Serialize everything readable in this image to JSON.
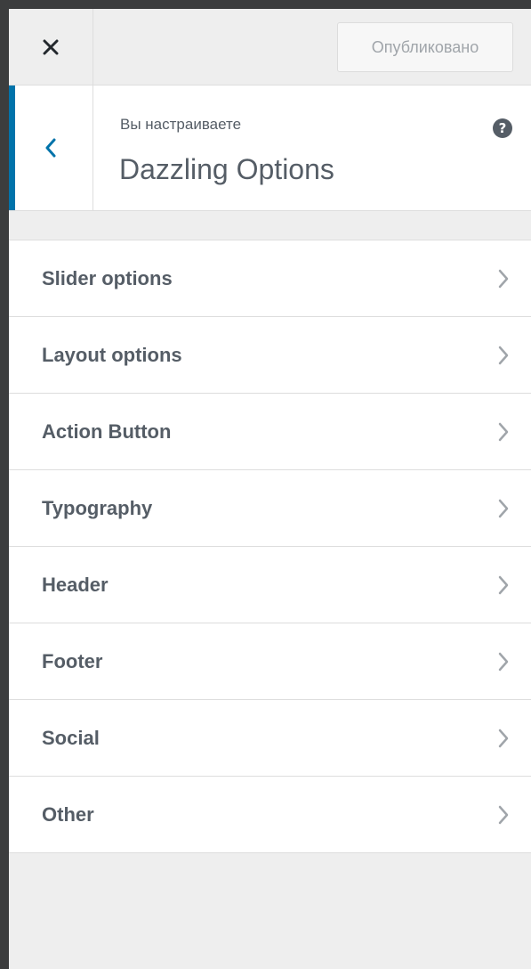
{
  "header": {
    "close_icon": "close-icon",
    "publish_label": "Опубликовано"
  },
  "section": {
    "back_icon": "chevron-left-icon",
    "customizing_label": "Вы настраиваете",
    "title": "Dazzling Options",
    "help_glyph": "?",
    "accent_color": "#0073aa"
  },
  "menu": {
    "item_icon": "chevron-right-icon",
    "items": [
      {
        "label": "Slider options"
      },
      {
        "label": "Layout options"
      },
      {
        "label": "Action Button"
      },
      {
        "label": "Typography"
      },
      {
        "label": "Header"
      },
      {
        "label": "Footer"
      },
      {
        "label": "Social"
      },
      {
        "label": "Other"
      }
    ]
  }
}
